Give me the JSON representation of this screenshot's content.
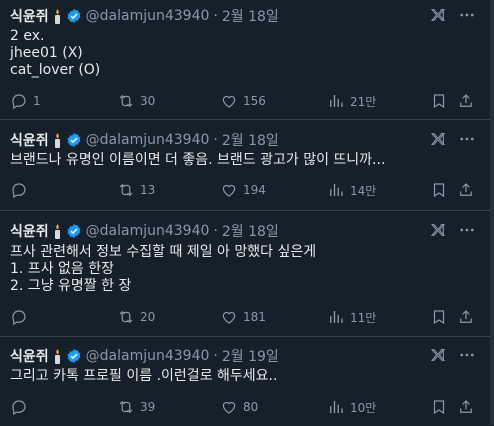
{
  "tweets": [
    {
      "name": "식윤쥐",
      "handle": "@dalamjun43940",
      "separator": "·",
      "date": "2월 18일",
      "lines": [
        "2 ex.",
        "jhee01 (X)",
        "cat_lover (O)"
      ],
      "replies": "1",
      "retweets": "30",
      "likes": "156",
      "views": "21만"
    },
    {
      "name": "식윤쥐",
      "handle": "@dalamjun43940",
      "separator": "·",
      "date": "2월 18일",
      "lines": [
        "브랜드나 유명인 이름이면 더 좋음. 브랜드 광고가 많이 뜨니까..."
      ],
      "replies": "",
      "retweets": "13",
      "likes": "194",
      "views": "14만"
    },
    {
      "name": "식윤쥐",
      "handle": "@dalamjun43940",
      "separator": "·",
      "date": "2월 18일",
      "lines": [
        "프사 관련해서 정보 수집할 때 제일 아 망했다 싶은게",
        "1. 프사 없음 한장",
        "2. 그냥 유명짤 한 장"
      ],
      "replies": "",
      "retweets": "20",
      "likes": "181",
      "views": "11만"
    },
    {
      "name": "식윤쥐",
      "handle": "@dalamjun43940",
      "separator": "·",
      "date": "2월 19일",
      "lines": [
        "그리고 카톡 프로필 이름 .이런걸로 해두세요.."
      ],
      "replies": "",
      "retweets": "39",
      "likes": "80",
      "views": "10만"
    }
  ],
  "colors": {
    "background": "#15202b",
    "text": "#e7e9ea",
    "muted": "#8b98a5",
    "verified": "#1d9bf0",
    "divider": "#38444d"
  },
  "icons": [
    "candle-icon",
    "verified-badge-icon",
    "grok-icon",
    "more-icon",
    "reply-icon",
    "retweet-icon",
    "like-icon",
    "views-icon",
    "bookmark-icon",
    "share-icon"
  ]
}
